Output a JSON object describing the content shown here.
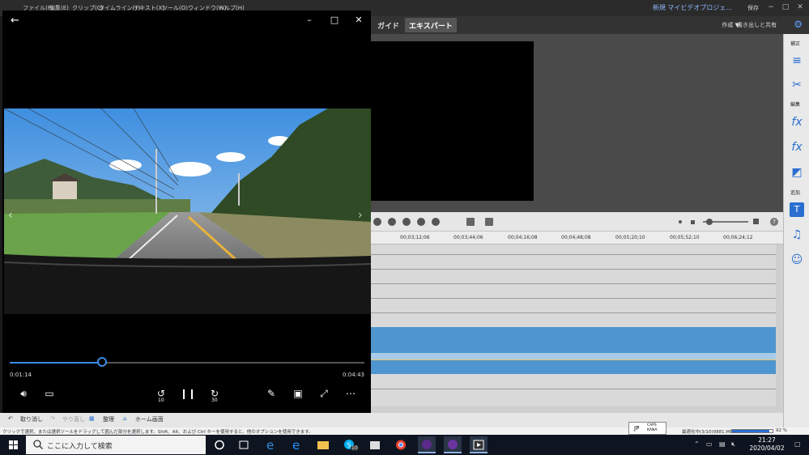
{
  "premiere": {
    "menus": [
      "ファイル(F)",
      "編集(E)",
      "クリップ(C)",
      "タイムライン(T)",
      "テキスト(X)",
      "ツール(O)",
      "ウィンドウ(W)",
      "ヘルプ(H)"
    ],
    "project_title": "新規 マイビデオプロジェ...",
    "save_label": "保存",
    "tab_guide": "ガイド",
    "tab_expert": "エキスパート",
    "create_label": "作成 ▼",
    "export_label": "書き出しと共有",
    "panel_labels": {
      "adjust": "補正",
      "edit": "編集",
      "add": "追加"
    },
    "ruler_ticks": [
      "00;03;12;06",
      "00;03;44;06",
      "00;04;16;08",
      "00;04;48;08",
      "00;05;20;10",
      "00;05;52;10",
      "00;06;24;12"
    ],
    "bottom": {
      "undo": "取り消し",
      "redo": "やり直し",
      "organize": "整理",
      "home": "ホーム画面"
    },
    "status_text": "クリックで選択、または選択ツールをドラッグして囲んだ部分を選択します。Shift、Alt、および Ctrl キーを使用すると、他のオプションを使用できます。",
    "render_label": "最適化中(3/10)0881.MP",
    "render_percent": "92 %",
    "render_progress": 0.92
  },
  "ime": {
    "mode": "JP",
    "caps": "CAPS",
    "kana": "KANA"
  },
  "player": {
    "time_elapsed": "0:01:14",
    "time_total": "0:04:43",
    "progress": 0.26,
    "skip_back": "10",
    "skip_forward": "30"
  },
  "taskbar": {
    "search_placeholder": "ここに入力して検索",
    "time": "21:27",
    "date": "2020/04/02",
    "skype_badge": "10"
  }
}
